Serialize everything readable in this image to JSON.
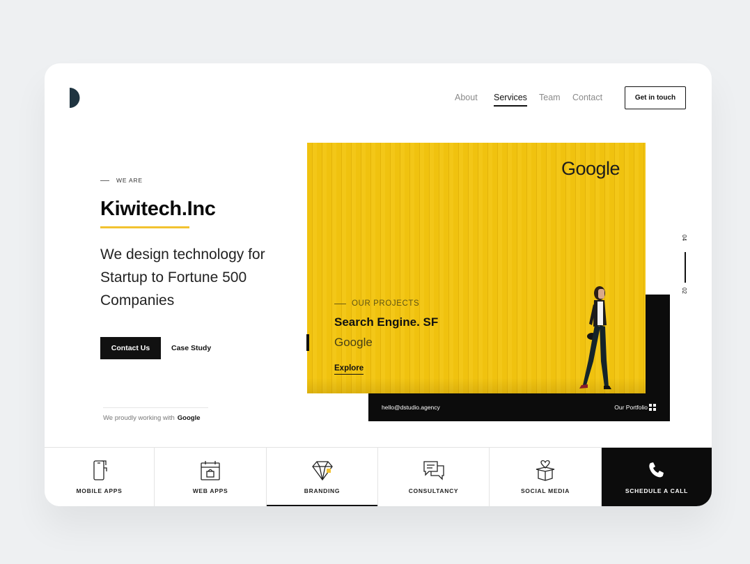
{
  "colors": {
    "accent": "#f2c230",
    "hero_yellow": "#f0c20f",
    "dark": "#0c0c0c",
    "page_bg": "#eef0f2"
  },
  "header": {
    "logo_icon": "half-circle-logo",
    "nav": [
      {
        "label": "About",
        "active": false
      },
      {
        "label": "Services",
        "active": true
      },
      {
        "label": "Team",
        "active": false
      },
      {
        "label": "Contact",
        "active": false
      }
    ],
    "cta_label": "Get in touch"
  },
  "intro": {
    "eyebrow": "WE ARE",
    "title": "Kiwitech.Inc",
    "tagline": "We design technology for Startup to Fortune 500 Companies",
    "primary_button": "Contact Us",
    "secondary_button": "Case Study",
    "partners_text": "We proudly working with",
    "partners_brand": "Google"
  },
  "hero": {
    "brand": "Google",
    "eyebrow": "OUR PROJECTS",
    "project_title": "Search Engine. SF",
    "project_client": "Google",
    "link_label": "Explore",
    "email": "hello@dstudio.agency",
    "portfolio_label": "Our Portfolio",
    "portfolio_icon": "grid-icon"
  },
  "pager": {
    "total": "04",
    "current": "02"
  },
  "services": [
    {
      "label": "MOBILE APPS",
      "icon": "mobile-phone-icon",
      "active": false
    },
    {
      "label": "WEB APPS",
      "icon": "calendar-bag-icon",
      "active": false
    },
    {
      "label": "BRANDING",
      "icon": "diamond-icon",
      "active": true
    },
    {
      "label": "CONSULTANCY",
      "icon": "chat-bubbles-icon",
      "active": false
    },
    {
      "label": "SOCIAL MEDIA",
      "icon": "heart-box-icon",
      "active": false
    },
    {
      "label": "SCHEDULE A CALL",
      "icon": "phone-icon",
      "active": false
    }
  ]
}
